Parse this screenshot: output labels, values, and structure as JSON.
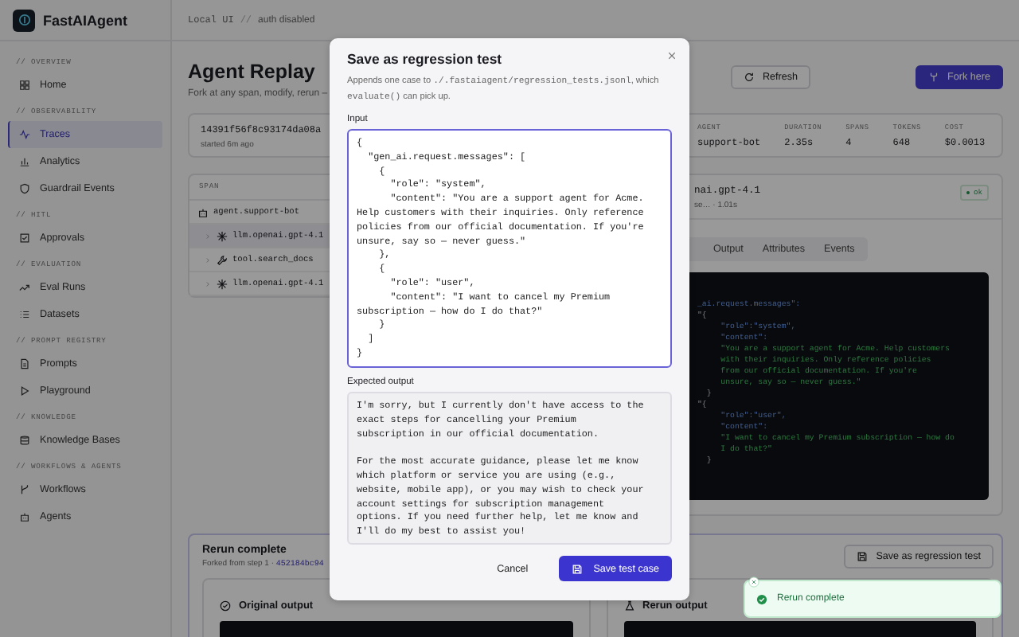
{
  "brand": {
    "name": "FastAIAgent"
  },
  "header": {
    "mode": "Local UI",
    "separator": "//",
    "auth": "auth disabled"
  },
  "sidebar": {
    "sections": [
      {
        "label": "// OVERVIEW",
        "items": [
          {
            "label": "Home",
            "selected": false
          }
        ]
      },
      {
        "label": "// OBSERVABILITY",
        "items": [
          {
            "label": "Traces",
            "selected": true
          },
          {
            "label": "Analytics",
            "selected": false
          },
          {
            "label": "Guardrail Events",
            "selected": false
          }
        ]
      },
      {
        "label": "// HITL",
        "items": [
          {
            "label": "Approvals",
            "selected": false
          }
        ]
      },
      {
        "label": "// EVALUATION",
        "items": [
          {
            "label": "Eval Runs",
            "selected": false
          },
          {
            "label": "Datasets",
            "selected": false
          }
        ]
      },
      {
        "label": "// PROMPT REGISTRY",
        "items": [
          {
            "label": "Prompts",
            "selected": false
          },
          {
            "label": "Playground",
            "selected": false
          }
        ]
      },
      {
        "label": "// KNOWLEDGE",
        "items": [
          {
            "label": "Knowledge Bases",
            "selected": false
          }
        ]
      },
      {
        "label": "// WORKFLOWS & AGENTS",
        "items": [
          {
            "label": "Workflows",
            "selected": false
          },
          {
            "label": "Agents",
            "selected": false
          }
        ]
      }
    ]
  },
  "page": {
    "title": "Agent Replay",
    "subtitle": "Fork at any span, modify, rerun –"
  },
  "actions": [
    {
      "label": "Refresh",
      "kind": "secondary"
    },
    {
      "label": "Fork here",
      "kind": "primary"
    }
  ],
  "trace": {
    "id": "14391f56f8c93174da08a",
    "started": "started 6m ago"
  },
  "stats": [
    {
      "label": "AGENT",
      "value": "support-bot"
    },
    {
      "label": "DURATION",
      "value": "2.35s"
    },
    {
      "label": "SPANS",
      "value": "4"
    },
    {
      "label": "TOKENS",
      "value": "648"
    },
    {
      "label": "COST",
      "value": "$0.0013"
    }
  ],
  "span_table": {
    "header": "SPAN",
    "rows": [
      {
        "name": "agent.support-bot",
        "kind": "agent",
        "selected": false,
        "children": [
          {
            "name": "llm.openai.gpt-4.1",
            "kind": "llm",
            "selected": true
          },
          {
            "name": "tool.search_docs",
            "kind": "tool",
            "selected": false
          },
          {
            "name": "llm.openai.gpt-4.1",
            "kind": "llm",
            "selected": false
          }
        ]
      }
    ]
  },
  "span_detail": {
    "title": "nai.gpt-4.1",
    "meta": "se… · 1.01s",
    "status": "ok",
    "tabs": [
      {
        "label": "Output",
        "selected": false
      },
      {
        "label": "Attributes",
        "selected": false
      },
      {
        "label": "Events",
        "selected": false
      }
    ],
    "code_lines": [
      {
        "text": "_ai.request.messages\":",
        "kind": "key"
      },
      {
        "text": "\"{",
        "kind": "punct"
      },
      {
        "text": "     \"role\":\"system\",",
        "kind": "key"
      },
      {
        "text": "     \"content\":",
        "kind": "key"
      },
      {
        "text": "     \"You are a support agent for Acme. Help customers",
        "kind": "string"
      },
      {
        "text": "     with their inquiries. Only reference policies",
        "kind": "string"
      },
      {
        "text": "     from our official documentation. If you're",
        "kind": "string"
      },
      {
        "text": "     unsure, say so — never guess.\"",
        "kind": "string"
      },
      {
        "text": "  }",
        "kind": "punct"
      },
      {
        "text": "\"{",
        "kind": "punct"
      },
      {
        "text": "     \"role\":\"user\",",
        "kind": "key"
      },
      {
        "text": "     \"content\":",
        "kind": "key"
      },
      {
        "text": "     \"I want to cancel my Premium subscription — how do",
        "kind": "string"
      },
      {
        "text": "     I do that?\"",
        "kind": "string"
      },
      {
        "text": "  }",
        "kind": "punct"
      }
    ]
  },
  "rerun": {
    "title": "Rerun complete",
    "forked": "Forked from step 1 ·",
    "fork_id": "452184bc94",
    "save_button": "Save as regression test",
    "cards": [
      {
        "title": "Original output"
      },
      {
        "title": "Rerun output"
      }
    ]
  },
  "dialog": {
    "title": "Save as regression test",
    "description": [
      {
        "text": "Appends one case to ",
        "kind": "text"
      },
      {
        "text": "./.fastaiagent/regression_tests.jsonl",
        "kind": "code"
      },
      {
        "text": ", which ",
        "kind": "text"
      },
      {
        "text": "evaluate()",
        "kind": "code"
      },
      {
        "text": " can pick up.",
        "kind": "text"
      }
    ],
    "fields": [
      {
        "label": "Input",
        "focused": true,
        "value": "{\n  \"gen_ai.request.messages\": [\n    {\n      \"role\": \"system\",\n      \"content\": \"You are a support agent for Acme.\nHelp customers with their inquiries. Only reference\npolicies from our official documentation. If you're\nunsure, say so — never guess.\"\n    },\n    {\n      \"role\": \"user\",\n      \"content\": \"I want to cancel my Premium\nsubscription — how do I do that?\"\n    }\n  ]\n}"
      },
      {
        "label": "Expected output",
        "focused": false,
        "value": "I'm sorry, but I currently don't have access to the\nexact steps for cancelling your Premium\nsubscription in our official documentation.\n\nFor the most accurate guidance, please let me know\nwhich platform or service you are using (e.g.,\nwebsite, mobile app), or you may wish to check your\naccount settings for subscription management\noptions. If you need further help, let me know and\nI'll do my best to assist you!"
      }
    ],
    "buttons": [
      {
        "label": "Cancel",
        "kind": "secondary"
      },
      {
        "label": "Save test case",
        "kind": "primary"
      }
    ]
  },
  "toast": {
    "message": "Rerun complete",
    "kind": "success"
  }
}
